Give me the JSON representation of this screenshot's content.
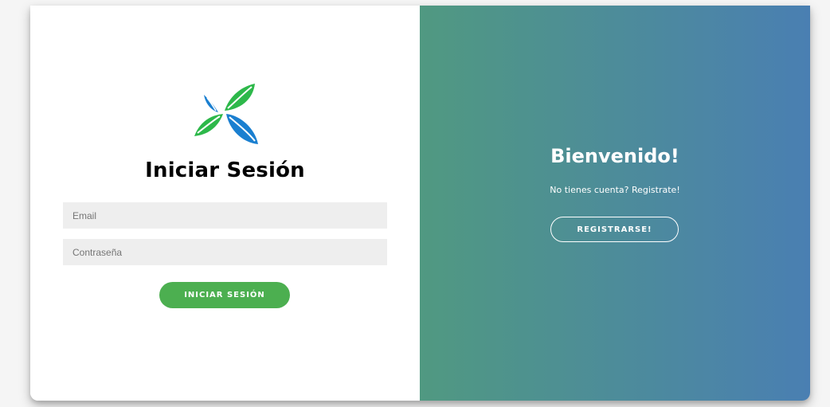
{
  "login": {
    "logo_icon": "leaf-logo-icon",
    "title": "Iniciar Sesión",
    "email_placeholder": "Email",
    "password_placeholder": "Contraseña",
    "submit_label": "INICIAR SESIÓN"
  },
  "welcome": {
    "title": "Bienvenido!",
    "text": "No tienes cuenta? Registrate!",
    "register_label": "REGISTRARSE!"
  },
  "colors": {
    "primary_green": "#4caf50",
    "gradient_start": "#509981",
    "gradient_end": "#4a7fb2",
    "logo_green": "#2db84a",
    "logo_blue": "#1a7fd0",
    "input_bg": "#eeeeee"
  }
}
